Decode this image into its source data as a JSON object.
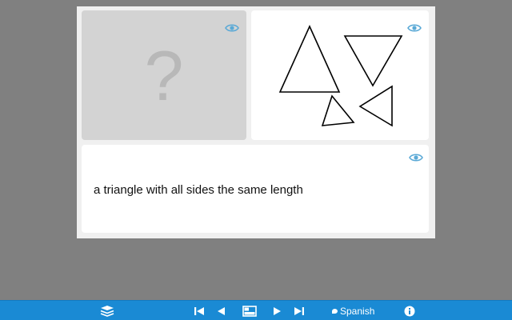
{
  "card": {
    "front_placeholder": "?",
    "definition": "a triangle with all sides the same length"
  },
  "icons": {
    "reveal": "eye-icon",
    "deck": "layers-icon",
    "first": "skip-first-icon",
    "prev": "previous-icon",
    "layout": "card-layout-icon",
    "next": "next-icon",
    "last": "skip-last-icon",
    "info": "info-icon"
  },
  "toolbar": {
    "language_label": "Spanish"
  },
  "colors": {
    "background": "#808080",
    "toolbar": "#1a8ad4",
    "eye": "#5aa9d6",
    "hidden_panel": "#d3d3d3"
  }
}
